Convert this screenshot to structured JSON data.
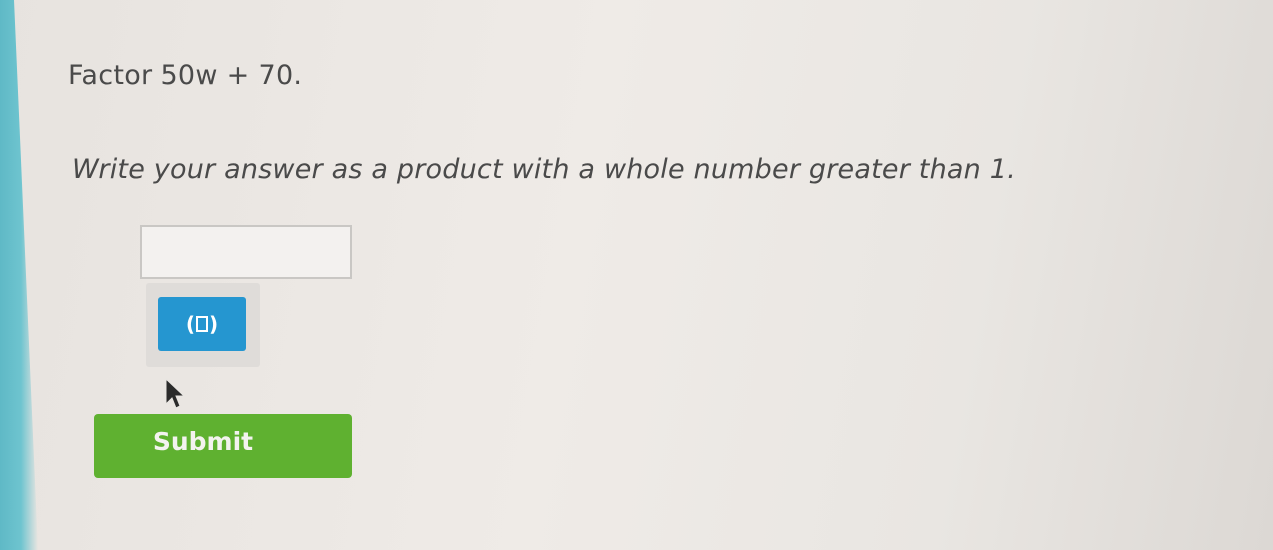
{
  "question": {
    "prompt": "Factor",
    "expression": "50w + 70."
  },
  "instruction": "Write your answer as a product with a whole number greater than 1.",
  "answer_input": {
    "value": "",
    "placeholder": ""
  },
  "keypad": {
    "parentheses_button_icon": "parentheses-icon",
    "parentheses_open": "(",
    "parentheses_close": ")"
  },
  "submit_label": "Submit",
  "colors": {
    "submit": "#5fb130",
    "keypad_button": "#2596d0",
    "text": "#4a4a4a"
  }
}
